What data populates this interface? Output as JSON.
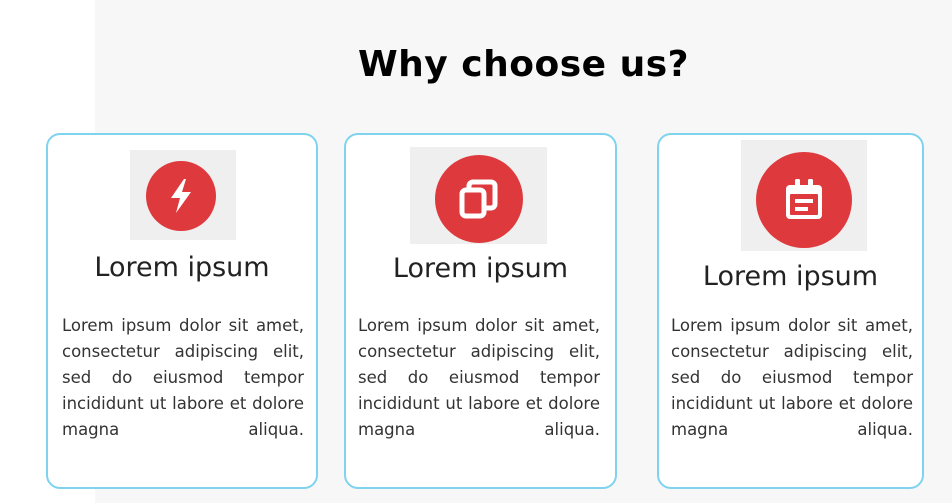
{
  "section": {
    "title": "Why choose us?"
  },
  "colors": {
    "accent": "#de3a3e",
    "card_border": "#7fd3ee",
    "background": "#f7f7f7"
  },
  "cards": [
    {
      "icon": "lightning-bolt-icon",
      "title": "Lorem ipsum",
      "text": "Lorem ipsum dolor sit amet, consectetur adipiscing elit, sed do eiusmod tempor incididunt ut labore et dolore magna aliqua."
    },
    {
      "icon": "copy-windows-icon",
      "title": "Lorem ipsum",
      "text": "Lorem ipsum dolor sit amet, consectetur adipiscing elit, sed do eiusmod tempor incididunt ut labore et dolore magna aliqua."
    },
    {
      "icon": "calendar-icon",
      "title": "Lorem ipsum",
      "text": "Lorem ipsum dolor sit amet, consectetur adipiscing elit, sed do eiusmod tempor incididunt ut labore et dolore magna aliqua."
    }
  ]
}
